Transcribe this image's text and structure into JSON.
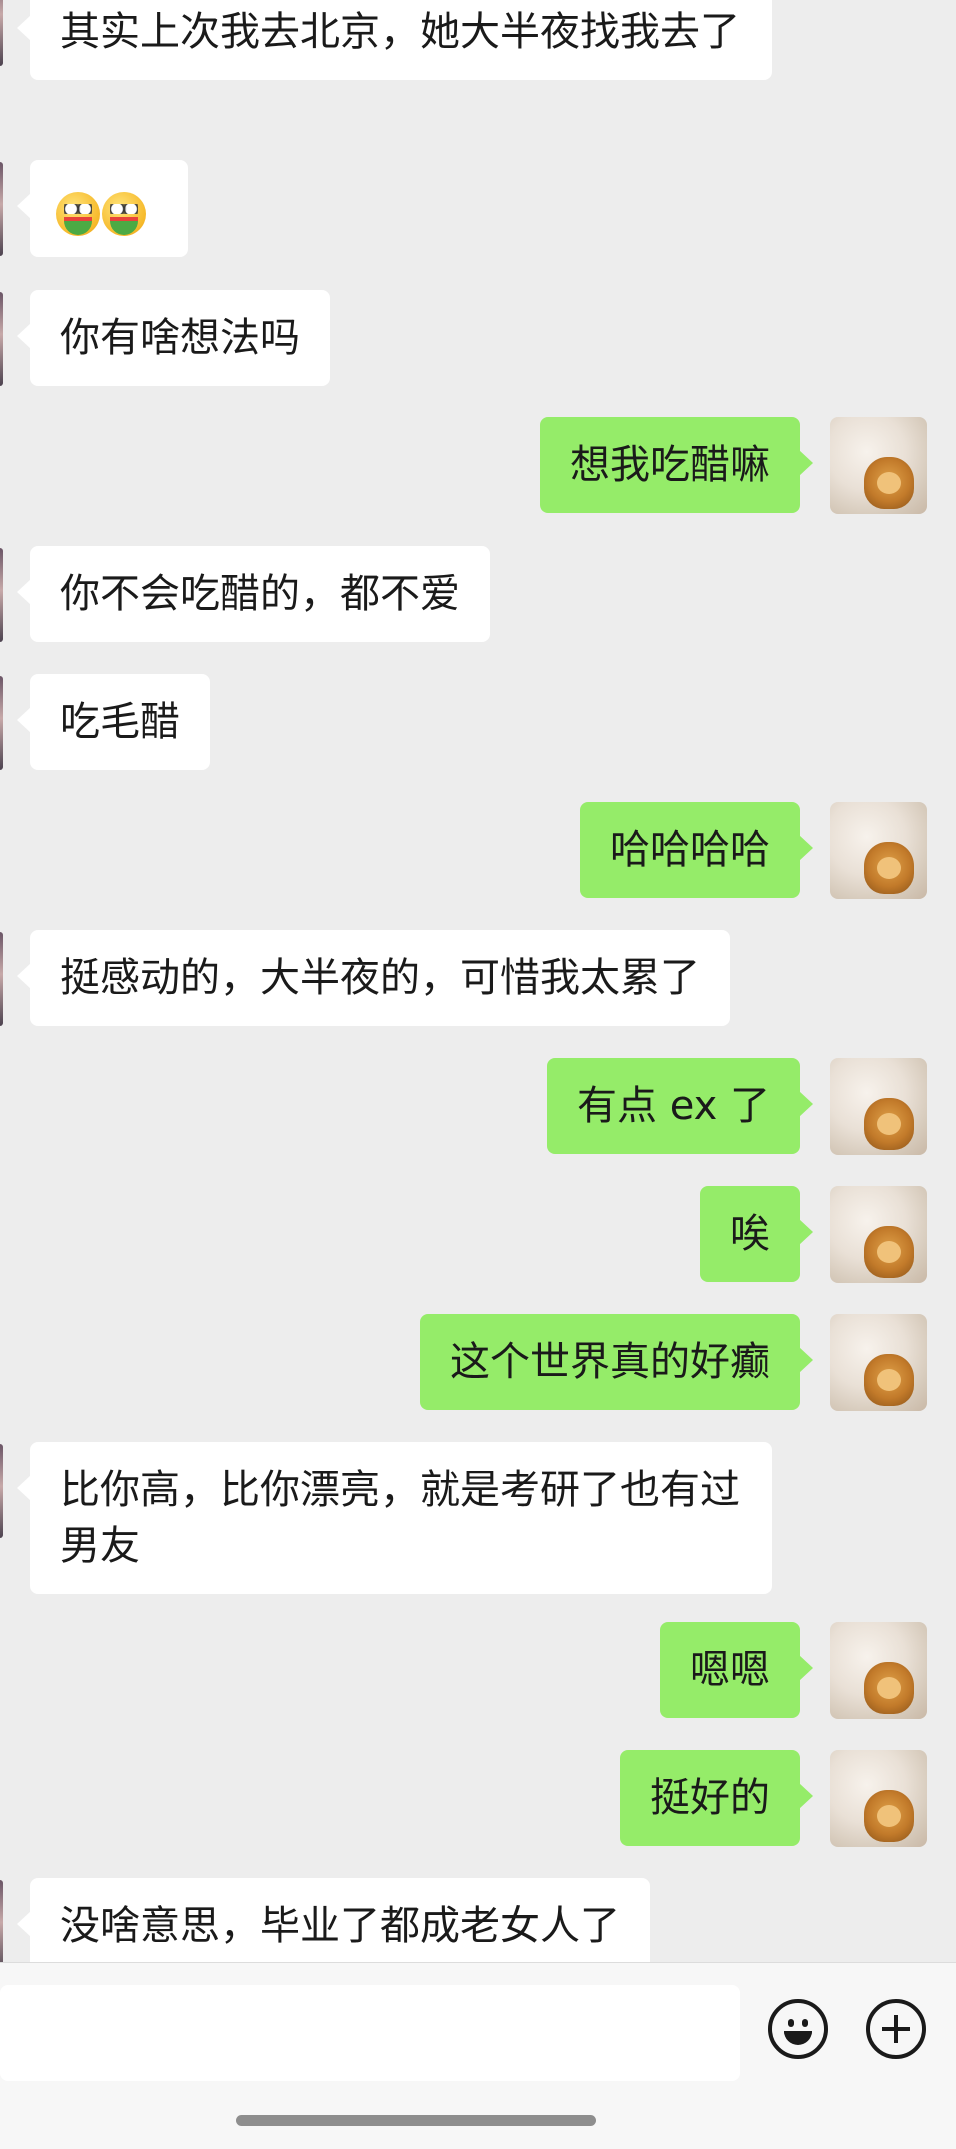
{
  "messages": [
    {
      "side": "in",
      "text": "其实上次我去北京，她大半夜找我去了"
    },
    {
      "side": "in",
      "emoji": [
        "grinning-watermelon-emoji",
        "grinning-watermelon-emoji"
      ]
    },
    {
      "side": "in",
      "text": "你有啥想法吗"
    },
    {
      "side": "out",
      "text": "想我吃醋嘛"
    },
    {
      "side": "in",
      "text": "你不会吃醋的，都不爱"
    },
    {
      "side": "in",
      "text": "吃毛醋"
    },
    {
      "side": "out",
      "text": "哈哈哈哈"
    },
    {
      "side": "in",
      "text": "挺感动的，大半夜的，可惜我太累了"
    },
    {
      "side": "out",
      "text": "有点 ex 了"
    },
    {
      "side": "out",
      "text": "唉"
    },
    {
      "side": "out",
      "text": "这个世界真的好癫"
    },
    {
      "side": "in",
      "text": "比你高，比你漂亮，就是考研了也有过男友"
    },
    {
      "side": "out",
      "text": "嗯嗯"
    },
    {
      "side": "out",
      "text": "挺好的"
    },
    {
      "side": "in",
      "text": "没啥意思，毕业了都成老女人了"
    }
  ],
  "input": {
    "value": "",
    "placeholder": ""
  },
  "icons": {
    "emoji_button": "smiley-icon",
    "more_button": "plus-circle-icon"
  },
  "colors": {
    "background": "#ededed",
    "incoming_bubble": "#ffffff",
    "outgoing_bubble": "#95ec69"
  }
}
